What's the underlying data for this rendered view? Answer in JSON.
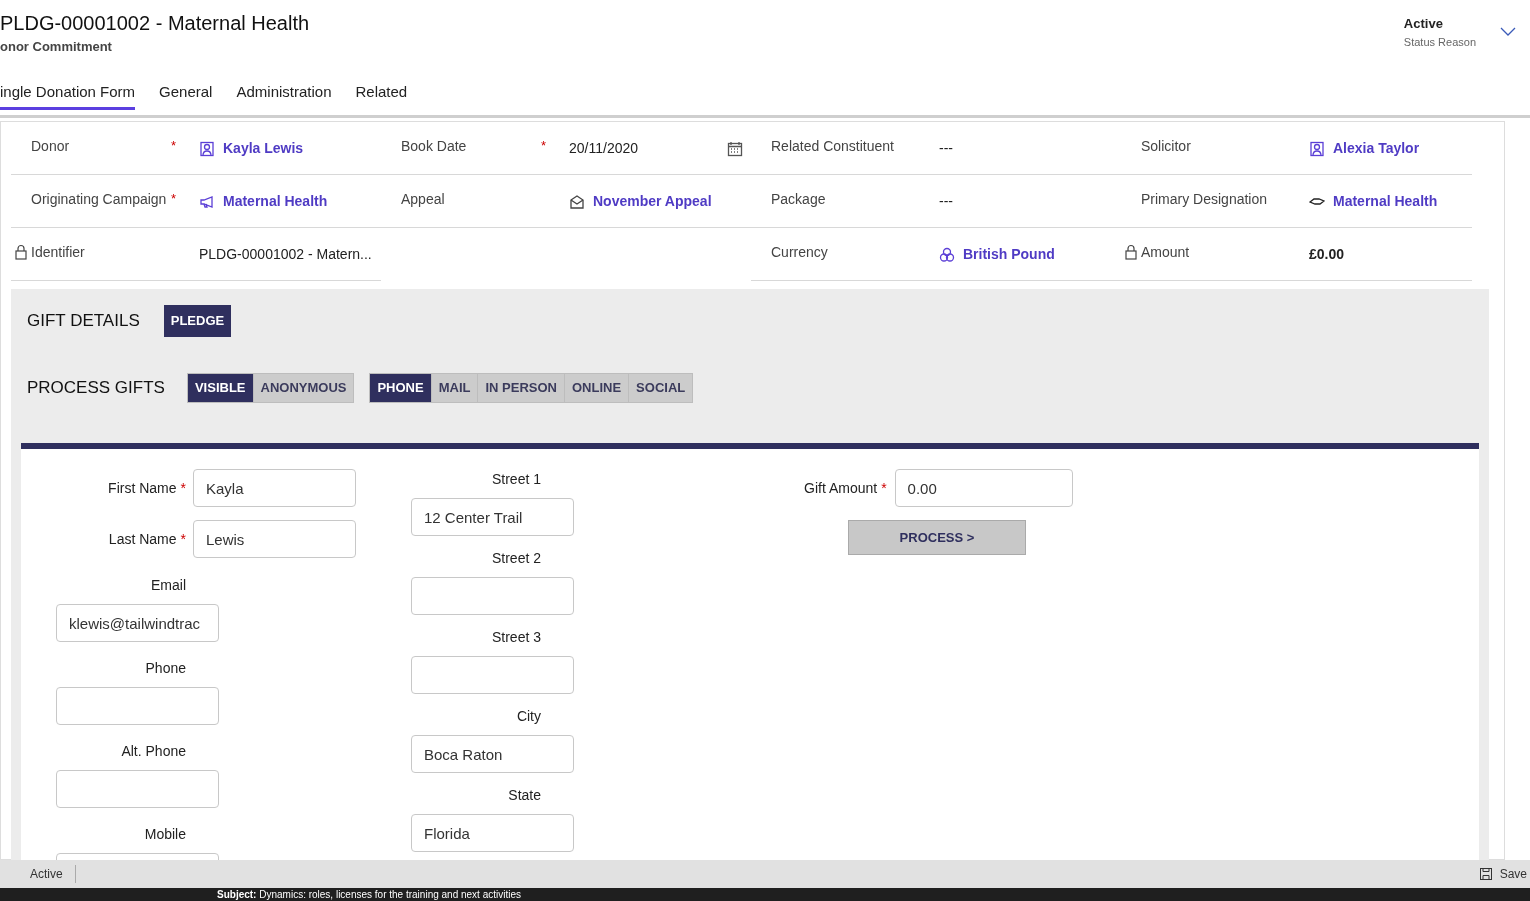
{
  "header": {
    "title": "PLDG-00001002 - Maternal Health",
    "subtitle": "onor Commitment",
    "status": {
      "value": "Active",
      "label": "Status Reason"
    }
  },
  "tabs": [
    {
      "label": "ingle Donation Form",
      "selected": true
    },
    {
      "label": "General",
      "selected": false
    },
    {
      "label": "Administration",
      "selected": false
    },
    {
      "label": "Related",
      "selected": false
    }
  ],
  "field_columns": [
    [
      {
        "label": "Donor",
        "required_mark": "*",
        "locked": false,
        "kind": "contact",
        "value": "Kayla Lewis"
      },
      {
        "label": "Originating Campaign",
        "required_mark": "*",
        "locked": false,
        "kind": "campaign",
        "value": "Maternal Health"
      },
      {
        "label": "Identifier",
        "locked": true,
        "kind": "text",
        "value": "PLDG-00001002 - Matern..."
      }
    ],
    [
      {
        "label": "Book Date",
        "required_mark": "*",
        "locked": false,
        "kind": "date",
        "value": "20/11/2020"
      },
      {
        "label": "Appeal",
        "locked": false,
        "kind": "appeal",
        "value": "November Appeal"
      }
    ],
    [
      {
        "label": "Related Constituent",
        "locked": false,
        "kind": "text",
        "value": "---"
      },
      {
        "label": "Package",
        "locked": false,
        "kind": "text",
        "value": "---"
      },
      {
        "label": "Currency",
        "locked": false,
        "kind": "currency",
        "value": "British Pound"
      }
    ],
    [
      {
        "label": "Solicitor",
        "locked": false,
        "kind": "contact",
        "value": "Alexia Taylor"
      },
      {
        "label": "Primary Designation",
        "locked": false,
        "kind": "designation",
        "value": "Maternal Health"
      },
      {
        "label": "Amount",
        "locked": true,
        "kind": "bold",
        "value": "£0.00"
      }
    ]
  ],
  "gift_details": {
    "title": "GIFT DETAILS",
    "badge": "PLEDGE"
  },
  "process_gifts": {
    "title": "PROCESS GIFTS",
    "groups": [
      [
        {
          "label": "VISIBLE",
          "selected": true
        },
        {
          "label": "ANONYMOUS",
          "selected": false
        }
      ],
      [
        {
          "label": "PHONE",
          "selected": true
        },
        {
          "label": "MAIL",
          "selected": false
        },
        {
          "label": "IN PERSON",
          "selected": false
        },
        {
          "label": "ONLINE",
          "selected": false
        },
        {
          "label": "SOCIAL",
          "selected": false
        }
      ]
    ]
  },
  "contact_fields": [
    {
      "kind": "inline",
      "label": "First Name",
      "required_mark": "*",
      "value": "Kayla"
    },
    {
      "kind": "inline",
      "label": "Last Name",
      "required_mark": "*",
      "value": "Lewis"
    },
    {
      "kind": "stacked",
      "label": "Email",
      "value": "klewis@tailwindtrac"
    },
    {
      "kind": "stacked",
      "label": "Phone"
    },
    {
      "kind": "stacked",
      "label": "Alt. Phone"
    },
    {
      "kind": "stacked",
      "label": "Mobile"
    }
  ],
  "address_fields": [
    {
      "label": "Street 1",
      "value": "12 Center Trail"
    },
    {
      "label": "Street 2"
    },
    {
      "label": "Street 3"
    },
    {
      "label": "City",
      "value": "Boca Raton"
    },
    {
      "label": "State",
      "value": "Florida"
    }
  ],
  "gift_amount": {
    "label": "Gift Amount",
    "required_mark": "*",
    "value": "0.00"
  },
  "process_button": "PROCESS >",
  "status_bar": {
    "status": "Active",
    "save": "Save"
  },
  "notification": {
    "prefix": "Subject:",
    "text": "Dynamics: roles, licenses for the training and next activities"
  }
}
